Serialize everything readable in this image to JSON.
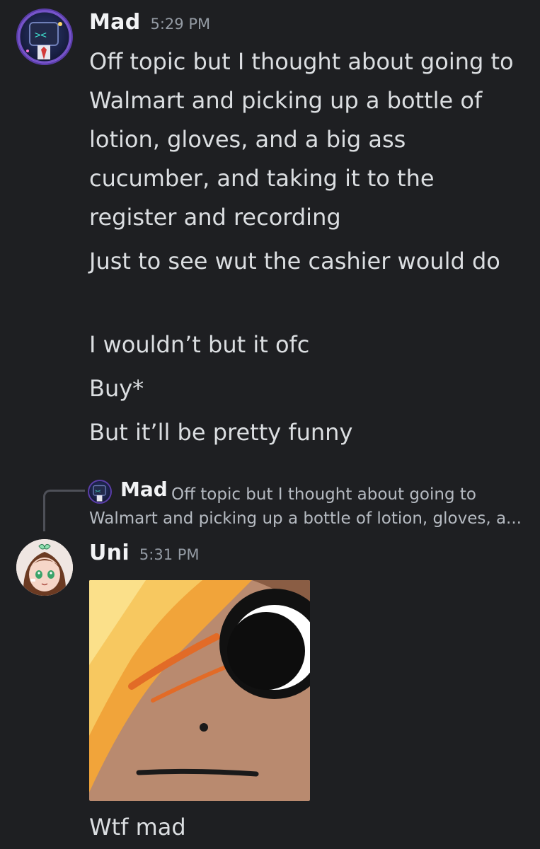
{
  "messages": [
    {
      "author": "Mad",
      "time": "5:29 PM",
      "avatar_icon": "robot-monitor-avatar-icon",
      "lines": [
        "Off topic but I thought about going to Walmart and picking up a bottle of lotion, gloves, and a big ass cucumber, and taking it to the register and recording",
        "Just to see wut the cashier would do",
        "I wouldn’t but it ofc",
        "Buy*",
        "But it’ll be pretty funny"
      ]
    },
    {
      "author": "Uni",
      "time": "5:31 PM",
      "avatar_icon": "anime-girl-avatar-icon",
      "reply": {
        "author": "Mad",
        "preview": "Off topic but I thought about going to Walmart and picking up a bottle of lotion, gloves, a..."
      },
      "attachment_icon": "cartoon-face-closeup-image",
      "lines": [
        "Wtf mad"
      ]
    }
  ],
  "colors": {
    "background": "#1e1f22",
    "username": "#f2f3f5",
    "text": "#dbdee1",
    "timestamp": "#949ba4",
    "reply_text": "#b5bac1"
  }
}
